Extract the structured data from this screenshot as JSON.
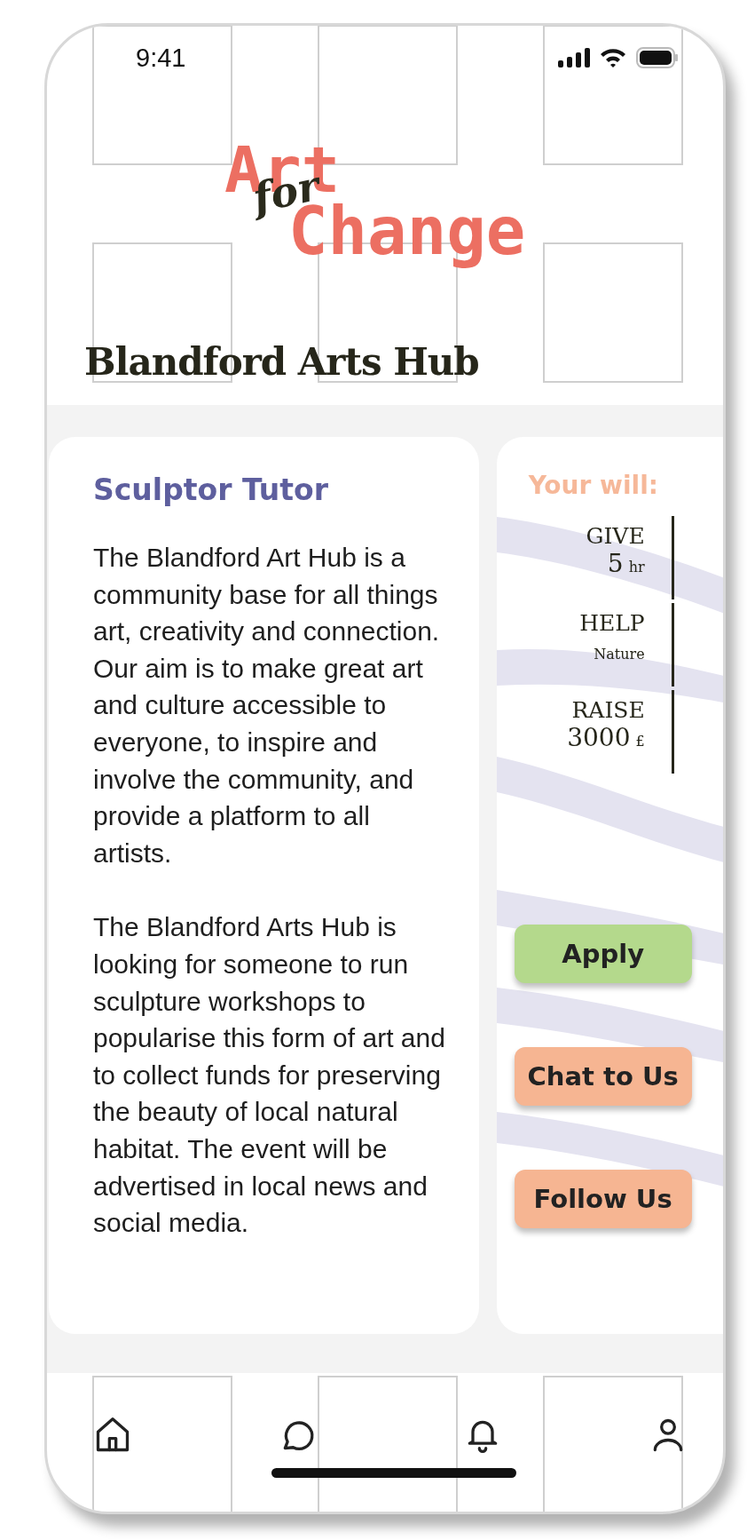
{
  "status_bar": {
    "time": "9:41"
  },
  "logo": {
    "top": "Art",
    "middle": "for",
    "bottom": "Change"
  },
  "title": "Blandford Arts Hub",
  "role": "Sculptor Tutor",
  "paragraphs": [
    "The Blandford Art Hub is a community base for all things art, creativity and connection. Our aim is to make great art and culture accessible to everyone, to inspire and involve the community, and provide a platform to all artists.",
    "The Blandford Arts Hub is looking for someone to run sculpture workshops to popularise this form of art and to collect funds for preserving the beauty of local natural habitat. The event will be advertised in local news and social media."
  ],
  "will": {
    "heading": "Your will:",
    "items": [
      {
        "verb": "GIVE",
        "amount": "5",
        "unit": "hr"
      },
      {
        "verb": "HELP",
        "unit": "Nature"
      },
      {
        "verb": "RAISE",
        "amount": "3000",
        "unit": "£"
      }
    ]
  },
  "buttons": [
    {
      "label": "Apply",
      "color": "#b4d98c"
    },
    {
      "label": "Chat to Us",
      "color": "#f6b592"
    },
    {
      "label": "Follow Us",
      "color": "#f6b592"
    }
  ],
  "nav": [
    {
      "kind": "home"
    },
    {
      "kind": "chat"
    },
    {
      "kind": "bell"
    },
    {
      "kind": "profile"
    }
  ]
}
